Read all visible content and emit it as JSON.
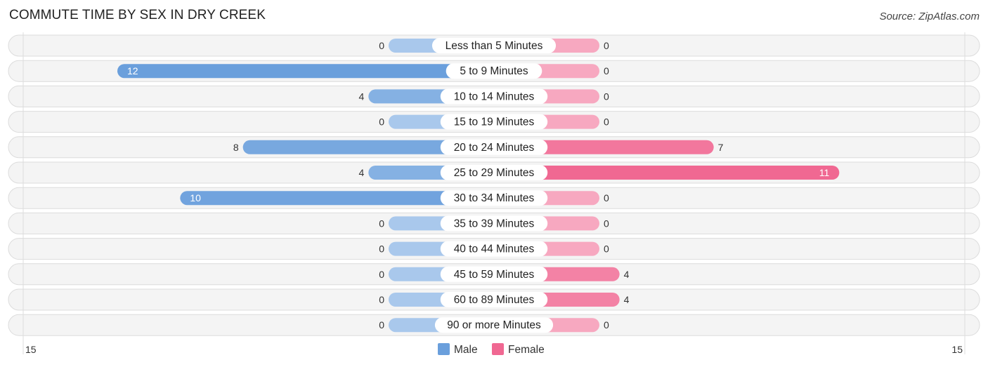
{
  "header": {
    "title": "COMMUTE TIME BY SEX IN DRY CREEK",
    "source": "Source: ZipAtlas.com"
  },
  "chart_data": {
    "type": "bar",
    "orientation": "horizontal-diverging",
    "title": "COMMUTE TIME BY SEX IN DRY CREEK",
    "categories": [
      "Less than 5 Minutes",
      "5 to 9 Minutes",
      "10 to 14 Minutes",
      "15 to 19 Minutes",
      "20 to 24 Minutes",
      "25 to 29 Minutes",
      "30 to 34 Minutes",
      "35 to 39 Minutes",
      "40 to 44 Minutes",
      "45 to 59 Minutes",
      "60 to 89 Minutes",
      "90 or more Minutes"
    ],
    "series": [
      {
        "name": "Male",
        "color": "#6a9fdc",
        "values": [
          0,
          12,
          4,
          0,
          8,
          4,
          10,
          0,
          0,
          0,
          0,
          0
        ]
      },
      {
        "name": "Female",
        "color": "#f06892",
        "values": [
          0,
          0,
          0,
          0,
          7,
          11,
          0,
          0,
          0,
          4,
          4,
          0
        ]
      }
    ],
    "axis": {
      "left_label": "15",
      "right_label": "15",
      "max": 15
    },
    "legend": {
      "position": "bottom-center",
      "items": [
        "Male",
        "Female"
      ]
    },
    "colors": {
      "male_light": "#a9c8ec",
      "male_dark": "#6a9fdc",
      "female_light": "#f7a8c0",
      "female_dark": "#f06892",
      "row_bg": "#f4f4f4"
    }
  }
}
